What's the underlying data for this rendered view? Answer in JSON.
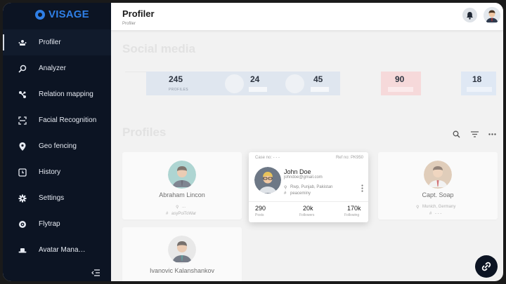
{
  "brand": {
    "name": "VISAGE"
  },
  "sidebar": {
    "items": [
      {
        "label": "Profiler",
        "icon": "profiler-icon",
        "active": true
      },
      {
        "label": "Analyzer",
        "icon": "search-icon",
        "active": false
      },
      {
        "label": "Relation mapping",
        "icon": "relation-icon",
        "active": false
      },
      {
        "label": "Facial Recognition",
        "icon": "face-scan-icon",
        "active": false
      },
      {
        "label": "Geo fencing",
        "icon": "location-pin-icon",
        "active": false
      },
      {
        "label": "History",
        "icon": "history-icon",
        "active": false
      },
      {
        "label": "Settings",
        "icon": "gear-icon",
        "active": false
      },
      {
        "label": "Flytrap",
        "icon": "flytrap-icon",
        "active": false
      },
      {
        "label": "Avatar Mana…",
        "icon": "avatar-hat-icon",
        "active": false
      }
    ]
  },
  "topbar": {
    "title": "Profiler",
    "breadcrumb": "Profiler"
  },
  "social_media": {
    "title": "Social media",
    "stats": [
      {
        "value": "245",
        "label": "PROFILES"
      },
      {
        "value": "24"
      },
      {
        "value": "45"
      },
      {
        "value": "90"
      },
      {
        "value": "18"
      }
    ]
  },
  "profiles": {
    "title": "Profiles",
    "cards": [
      {
        "name": "Abraham Lincon",
        "location": "...",
        "tag": "asyPoiToWar"
      },
      {
        "case_label": "Case no: - - -",
        "ref_label": "Ref no: PK950",
        "name": "John Doe",
        "email": "johndoe@gmail.com",
        "location": "Rwp, Punjab, Pakistan",
        "tag": "peaceminy",
        "posts": "290",
        "posts_label": "Posts",
        "followers": "20k",
        "followers_label": "Followers",
        "following": "170k",
        "following_label": "Following"
      },
      {
        "name": "Capt. Soap",
        "location": "Munich, Germany",
        "tag": "- - -"
      },
      {
        "name": "Ivanovic Kalanshankov"
      }
    ]
  },
  "colors": {
    "sidebar_bg": "#0c1423",
    "brand": "#2f7fe6",
    "red_stat": "#f6d9da",
    "blue_stat": "#dfe8f4"
  }
}
